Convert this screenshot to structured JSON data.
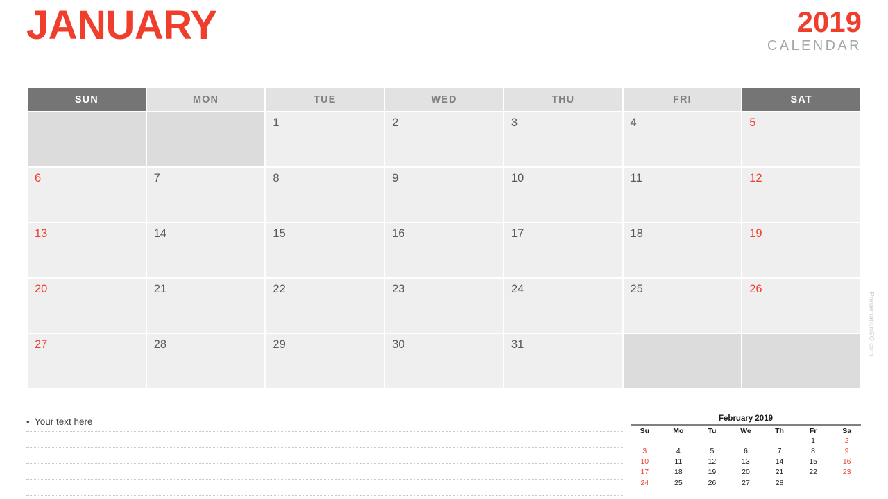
{
  "header": {
    "month": "JANUARY",
    "year": "2019",
    "subtitle": "CALENDAR"
  },
  "colors": {
    "accent_red": "#ef3e2c",
    "header_dark": "#757575",
    "header_light": "#e2e2e2",
    "cell_active": "#efefef",
    "cell_blank": "#dcdcdc",
    "text_gray": "#595959",
    "subtitle_gray": "#a6a6a6"
  },
  "grid": {
    "day_headers": [
      {
        "label": "SUN",
        "weekend": true
      },
      {
        "label": "MON",
        "weekend": false
      },
      {
        "label": "TUE",
        "weekend": false
      },
      {
        "label": "WED",
        "weekend": false
      },
      {
        "label": "THU",
        "weekend": false
      },
      {
        "label": "FRI",
        "weekend": false
      },
      {
        "label": "SAT",
        "weekend": true
      }
    ],
    "weeks": [
      [
        {
          "num": "",
          "blank": true,
          "red": false
        },
        {
          "num": "",
          "blank": true,
          "red": false
        },
        {
          "num": "1",
          "blank": false,
          "red": false
        },
        {
          "num": "2",
          "blank": false,
          "red": false
        },
        {
          "num": "3",
          "blank": false,
          "red": false
        },
        {
          "num": "4",
          "blank": false,
          "red": false
        },
        {
          "num": "5",
          "blank": false,
          "red": true
        }
      ],
      [
        {
          "num": "6",
          "blank": false,
          "red": true
        },
        {
          "num": "7",
          "blank": false,
          "red": false
        },
        {
          "num": "8",
          "blank": false,
          "red": false
        },
        {
          "num": "9",
          "blank": false,
          "red": false
        },
        {
          "num": "10",
          "blank": false,
          "red": false
        },
        {
          "num": "11",
          "blank": false,
          "red": false
        },
        {
          "num": "12",
          "blank": false,
          "red": true
        }
      ],
      [
        {
          "num": "13",
          "blank": false,
          "red": true
        },
        {
          "num": "14",
          "blank": false,
          "red": false
        },
        {
          "num": "15",
          "blank": false,
          "red": false
        },
        {
          "num": "16",
          "blank": false,
          "red": false
        },
        {
          "num": "17",
          "blank": false,
          "red": false
        },
        {
          "num": "18",
          "blank": false,
          "red": false
        },
        {
          "num": "19",
          "blank": false,
          "red": true
        }
      ],
      [
        {
          "num": "20",
          "blank": false,
          "red": true
        },
        {
          "num": "21",
          "blank": false,
          "red": false
        },
        {
          "num": "22",
          "blank": false,
          "red": false
        },
        {
          "num": "23",
          "blank": false,
          "red": false
        },
        {
          "num": "24",
          "blank": false,
          "red": false
        },
        {
          "num": "25",
          "blank": false,
          "red": false
        },
        {
          "num": "26",
          "blank": false,
          "red": true
        }
      ],
      [
        {
          "num": "27",
          "blank": false,
          "red": true
        },
        {
          "num": "28",
          "blank": false,
          "red": false
        },
        {
          "num": "29",
          "blank": false,
          "red": false
        },
        {
          "num": "30",
          "blank": false,
          "red": false
        },
        {
          "num": "31",
          "blank": false,
          "red": false
        },
        {
          "num": "",
          "blank": true,
          "red": false
        },
        {
          "num": "",
          "blank": true,
          "red": false
        }
      ]
    ]
  },
  "notes": {
    "bullet": "•",
    "first_line": "Your text here",
    "line_count": 5
  },
  "mini_calendar": {
    "title": "February 2019",
    "day_headers": [
      "Su",
      "Mo",
      "Tu",
      "We",
      "Th",
      "Fr",
      "Sa"
    ],
    "weeks": [
      [
        {
          "num": "",
          "red": false
        },
        {
          "num": "",
          "red": false
        },
        {
          "num": "",
          "red": false
        },
        {
          "num": "",
          "red": false
        },
        {
          "num": "",
          "red": false
        },
        {
          "num": "1",
          "red": false
        },
        {
          "num": "2",
          "red": true
        }
      ],
      [
        {
          "num": "3",
          "red": true
        },
        {
          "num": "4",
          "red": false
        },
        {
          "num": "5",
          "red": false
        },
        {
          "num": "6",
          "red": false
        },
        {
          "num": "7",
          "red": false
        },
        {
          "num": "8",
          "red": false
        },
        {
          "num": "9",
          "red": true
        }
      ],
      [
        {
          "num": "10",
          "red": true
        },
        {
          "num": "11",
          "red": false
        },
        {
          "num": "12",
          "red": false
        },
        {
          "num": "13",
          "red": false
        },
        {
          "num": "14",
          "red": false
        },
        {
          "num": "15",
          "red": false
        },
        {
          "num": "16",
          "red": true
        }
      ],
      [
        {
          "num": "17",
          "red": true
        },
        {
          "num": "18",
          "red": false
        },
        {
          "num": "19",
          "red": false
        },
        {
          "num": "20",
          "red": false
        },
        {
          "num": "21",
          "red": false
        },
        {
          "num": "22",
          "red": false
        },
        {
          "num": "23",
          "red": true
        }
      ],
      [
        {
          "num": "24",
          "red": true
        },
        {
          "num": "25",
          "red": false
        },
        {
          "num": "26",
          "red": false
        },
        {
          "num": "27",
          "red": false
        },
        {
          "num": "28",
          "red": false
        },
        {
          "num": "",
          "red": false
        },
        {
          "num": "",
          "red": false
        }
      ]
    ]
  },
  "watermark": {
    "text": "PresentationGO.com"
  }
}
